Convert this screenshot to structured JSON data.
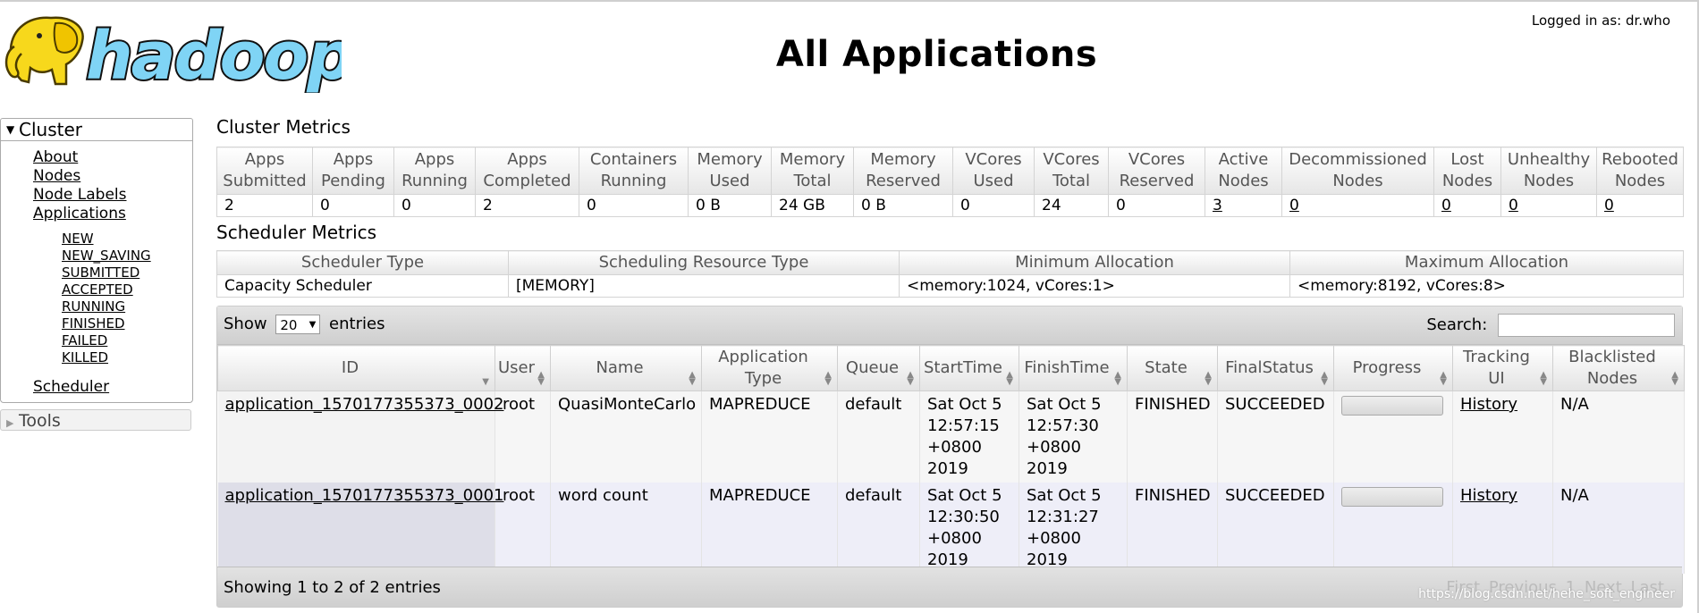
{
  "header": {
    "title": "All Applications",
    "logged_in": "Logged in as: dr.who",
    "logo_text": "hadoop"
  },
  "sidebar": {
    "cluster_label": "Cluster",
    "cluster_links": [
      "About",
      "Nodes",
      "Node Labels",
      "Applications"
    ],
    "state_links": [
      "NEW",
      "NEW_SAVING",
      "SUBMITTED",
      "ACCEPTED",
      "RUNNING",
      "FINISHED",
      "FAILED",
      "KILLED"
    ],
    "scheduler_label": "Scheduler",
    "tools_label": "Tools"
  },
  "cluster_metrics": {
    "title": "Cluster Metrics",
    "headers": [
      "Apps Submitted",
      "Apps Pending",
      "Apps Running",
      "Apps Completed",
      "Containers Running",
      "Memory Used",
      "Memory Total",
      "Memory Reserved",
      "VCores Used",
      "VCores Total",
      "VCores Reserved",
      "Active Nodes",
      "Decommissioned Nodes",
      "Lost Nodes",
      "Unhealthy Nodes",
      "Rebooted Nodes"
    ],
    "values": [
      "2",
      "0",
      "0",
      "2",
      "0",
      "0 B",
      "24 GB",
      "0 B",
      "0",
      "24",
      "0",
      "3",
      "0",
      "0",
      "0",
      "0"
    ]
  },
  "scheduler_metrics": {
    "title": "Scheduler Metrics",
    "headers": [
      "Scheduler Type",
      "Scheduling Resource Type",
      "Minimum Allocation",
      "Maximum Allocation"
    ],
    "values": [
      "Capacity Scheduler",
      "[MEMORY]",
      "<memory:1024, vCores:1>",
      "<memory:8192, vCores:8>"
    ]
  },
  "apps_table": {
    "show_label": "Show",
    "entries_label": "entries",
    "page_size": "20",
    "search_label": "Search:",
    "search_value": "",
    "headers": [
      "ID",
      "User",
      "Name",
      "Application Type",
      "Queue",
      "StartTime",
      "FinishTime",
      "State",
      "FinalStatus",
      "Progress",
      "Tracking UI",
      "Blacklisted Nodes"
    ],
    "rows": [
      {
        "id": "application_1570177355373_0002",
        "user": "root",
        "name": "QuasiMonteCarlo",
        "type": "MAPREDUCE",
        "queue": "default",
        "start_l1": "Sat Oct 5",
        "start_l2": "12:57:15",
        "start_l3": "+0800",
        "start_l4": "2019",
        "finish_l1": "Sat Oct 5",
        "finish_l2": "12:57:30",
        "finish_l3": "+0800",
        "finish_l4": "2019",
        "state": "FINISHED",
        "final_status": "SUCCEEDED",
        "tracking": "History",
        "blacklisted": "N/A"
      },
      {
        "id": "application_1570177355373_0001",
        "user": "root",
        "name": "word count",
        "type": "MAPREDUCE",
        "queue": "default",
        "start_l1": "Sat Oct 5",
        "start_l2": "12:30:50",
        "start_l3": "+0800",
        "start_l4": "2019",
        "finish_l1": "Sat Oct 5",
        "finish_l2": "12:31:27",
        "finish_l3": "+0800",
        "finish_l4": "2019",
        "state": "FINISHED",
        "final_status": "SUCCEEDED",
        "tracking": "History",
        "blacklisted": "N/A"
      }
    ],
    "info": "Showing 1 to 2 of 2 entries",
    "pager": [
      "First",
      "Previous",
      "1",
      "Next",
      "Last"
    ],
    "watermark": "https://blog.csdn.net/hehe_soft_engineer"
  },
  "colors": {
    "logo_yellow": "#f7d81c",
    "logo_blue": "#7fd4f5",
    "header_gradient_end": "#e3e3e3"
  }
}
